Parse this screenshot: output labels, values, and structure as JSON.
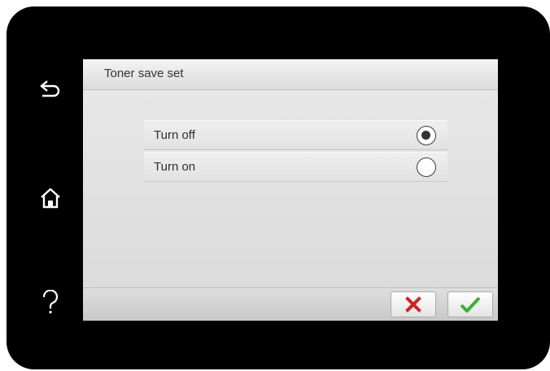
{
  "screen": {
    "title": "Toner save set"
  },
  "side_buttons": [
    {
      "name": "back",
      "icon": "back-arrow-icon"
    },
    {
      "name": "home",
      "icon": "home-icon"
    },
    {
      "name": "help",
      "icon": "help-icon"
    }
  ],
  "options": [
    {
      "label": "Turn off",
      "selected": true
    },
    {
      "label": "Turn on",
      "selected": false
    }
  ],
  "actions": {
    "cancel_icon": "cross-icon",
    "confirm_icon": "checkmark-icon"
  },
  "colors": {
    "cancel": "#d42020",
    "confirm": "#3cb034",
    "bezel": "#000000",
    "side_icon": "#ffffff"
  }
}
